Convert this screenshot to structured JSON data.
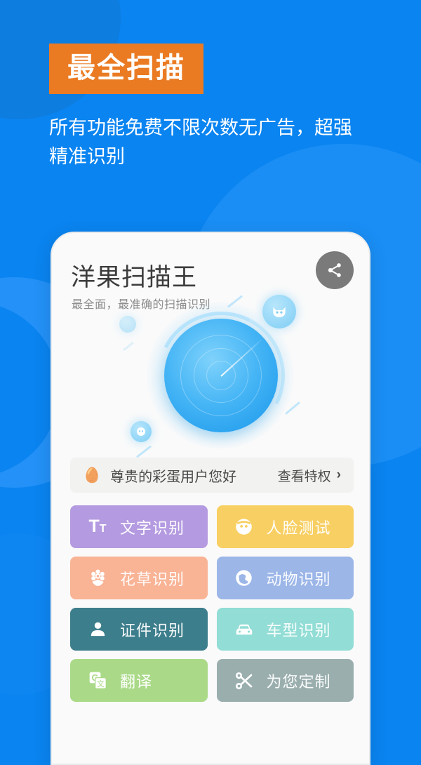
{
  "promo": {
    "badge_text": "最全扫描",
    "badge_color": "#ea7b23",
    "subhead": "所有功能免费不限次数无广告，超强精准识别",
    "background_color": "#0a84f0"
  },
  "app": {
    "title": "洋果扫描王",
    "subtitle": "最全面，最准确的扫描识别",
    "share_icon": "share-icon"
  },
  "radar": {
    "icon_cat": "cat-face-icon",
    "icon_face": "smiley-face-icon"
  },
  "banner": {
    "egg_icon": "easter-egg-icon",
    "text": "尊贵的彩蛋用户您好",
    "action_label": "查看特权",
    "chevron": "›"
  },
  "features": [
    {
      "label": "文字识别",
      "icon": "text-size-icon",
      "color": "#b49ae0"
    },
    {
      "label": "人脸测试",
      "icon": "face-icon",
      "color": "#f8cf63"
    },
    {
      "label": "花草识别",
      "icon": "flower-icon",
      "color": "#f9b395"
    },
    {
      "label": "动物识别",
      "icon": "globe-paw-icon",
      "color": "#9cb6e8"
    },
    {
      "label": "证件识别",
      "icon": "person-icon",
      "color": "#3d7e8c"
    },
    {
      "label": "车型识别",
      "icon": "car-icon",
      "color": "#92ddd5"
    },
    {
      "label": "翻译",
      "icon": "translate-icon",
      "color": "#aada88"
    },
    {
      "label": "为您定制",
      "icon": "scissors-icon",
      "color": "#9aaeae"
    }
  ]
}
